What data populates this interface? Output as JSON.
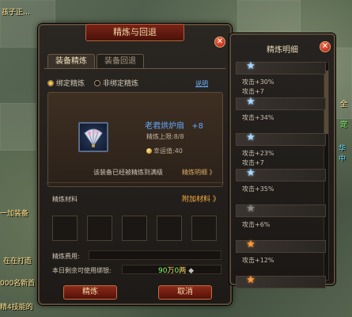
{
  "dialog": {
    "title": "精炼与回退",
    "tabs": [
      "装备精炼",
      "装备回退"
    ],
    "radios": [
      "绑定精炼",
      "非绑定精炼"
    ],
    "help": "说明",
    "item": {
      "name": "老君烘炉扇",
      "plus": "+8",
      "limit": "精炼上限:8/8",
      "luck": "幸运值:40"
    },
    "max_note": "该装备已经被精炼到满级",
    "detail_link": "精炼明细 》",
    "materials_label": "精炼材料",
    "add_materials": "附加材料 》",
    "fee_label": "精炼费用:",
    "silver_label": "本日剩余可使用绑银:",
    "silver": {
      "amount": "90",
      "unit": "万",
      "count": "0",
      "currency": "两"
    },
    "buttons": {
      "refine": "精炼",
      "cancel": "取消"
    },
    "close": "✕"
  },
  "detail": {
    "title": "精炼明细",
    "close": "✕",
    "rows": [
      {
        "star_color": "#a8d8ff",
        "bonuses": [
          "攻击+30%",
          "攻击+7"
        ]
      },
      {
        "star_color": "#a8d8ff",
        "bonuses": [
          "攻击+34%"
        ]
      },
      {
        "star_color": "#a8d8ff",
        "bonuses": [
          "攻击+23%",
          "攻击+7"
        ]
      },
      {
        "star_color": "#a8d8ff",
        "bonuses": [
          "攻击+35%"
        ]
      },
      {
        "star_color": "#8a8a8a",
        "bonuses": [
          "攻击+6%"
        ]
      },
      {
        "star_color": "#ff9a3a",
        "bonuses": [
          "攻击+12%"
        ]
      },
      {
        "star_color": "#ff9a3a",
        "bonuses": []
      }
    ]
  },
  "world": {
    "texts": [
      "孩子正…",
      "一加装备",
      "在在打造",
      "000名新首",
      "精4技能的",
      "宠",
      "华中",
      "全"
    ]
  }
}
